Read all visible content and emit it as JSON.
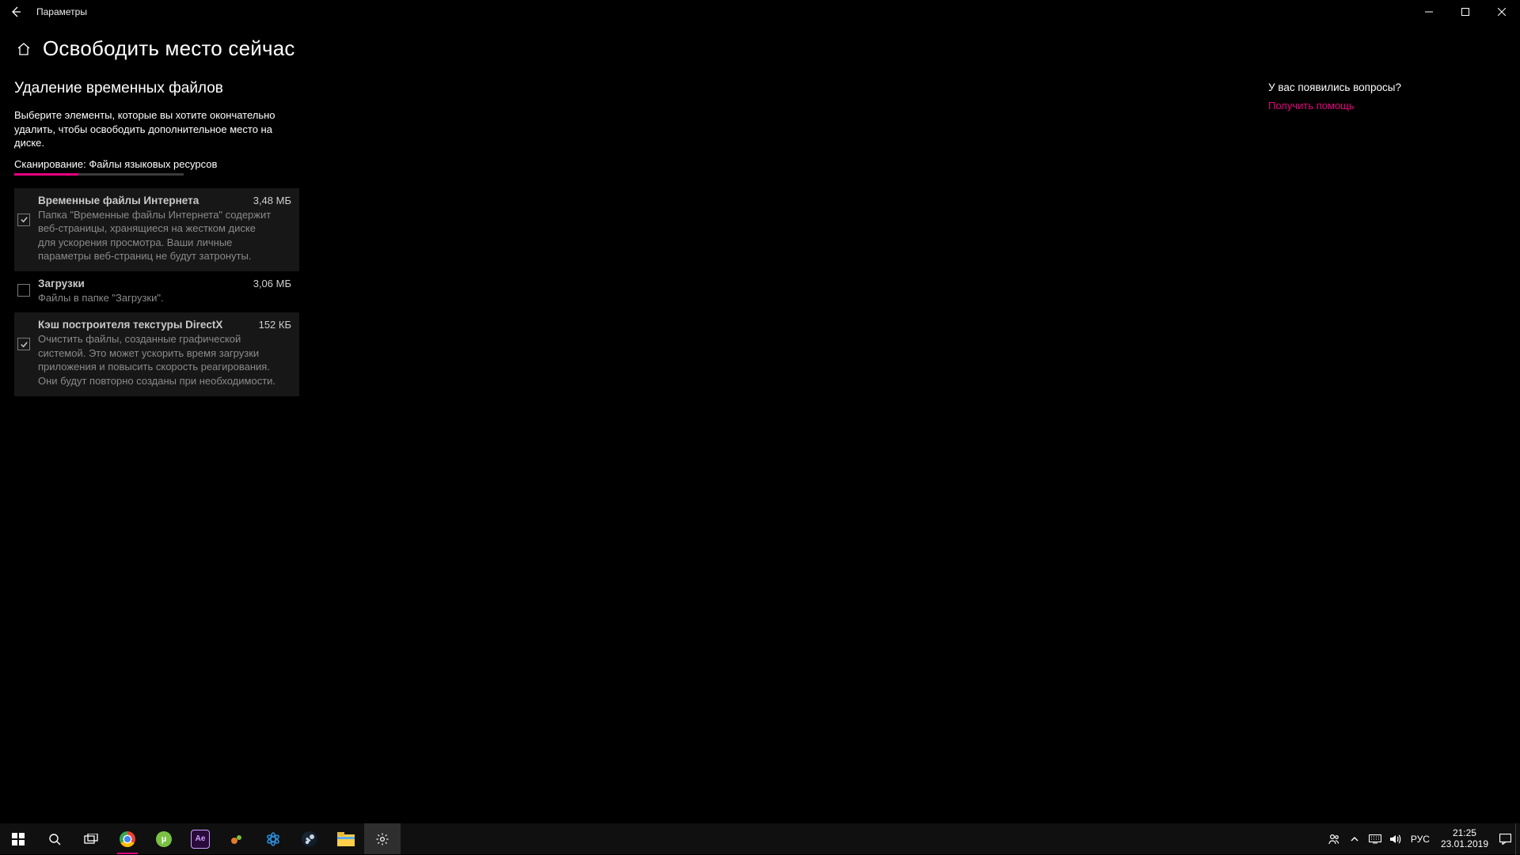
{
  "window": {
    "app_title": "Параметры"
  },
  "header": {
    "page_title": "Освободить место сейчас"
  },
  "main": {
    "section_title": "Удаление временных файлов",
    "section_desc": "Выберите элементы, которые вы хотите окончательно удалить, чтобы освободить дополнительное место на диске.",
    "scan_status": "Сканирование: Файлы языковых ресурсов",
    "progress_percent": 38,
    "items": [
      {
        "checked": true,
        "title": "Временные файлы Интернета",
        "size": "3,48 МБ",
        "desc": "Папка \"Временные файлы Интернета\" содержит веб-страницы, хранящиеся на жестком диске для ускорения просмотра. Ваши личные параметры веб-страниц не будут затронуты."
      },
      {
        "checked": false,
        "title": "Загрузки",
        "size": "3,06 МБ",
        "desc": "Файлы в папке \"Загрузки\"."
      },
      {
        "checked": true,
        "title": "Кэш построителя текстуры DirectX",
        "size": "152 КБ",
        "desc": "Очистить файлы, созданные графической системой. Это может ускорить время загрузки приложения и повысить скорость реагирования. Они будут повторно созданы при необходимости."
      }
    ]
  },
  "side": {
    "question": "У вас появились вопросы?",
    "help_link": "Получить помощь"
  },
  "taskbar": {
    "lang": "РУС",
    "time": "21:25",
    "date": "23.01.2019",
    "apps": [
      {
        "name": "chrome",
        "bg": "#fff",
        "accent": "#e6007e"
      },
      {
        "name": "utorrent",
        "bg": "#79c143",
        "accent": ""
      },
      {
        "name": "aftereffects",
        "bg": "#2a0a3a",
        "accent": ""
      },
      {
        "name": "app-orange",
        "bg": "#000",
        "accent": ""
      },
      {
        "name": "battlenet",
        "bg": "#000",
        "accent": ""
      },
      {
        "name": "steam",
        "bg": "#000",
        "accent": ""
      },
      {
        "name": "file-explorer",
        "bg": "#ffcf4b",
        "accent": ""
      },
      {
        "name": "settings",
        "bg": "transparent",
        "accent": "",
        "active": true
      }
    ]
  }
}
